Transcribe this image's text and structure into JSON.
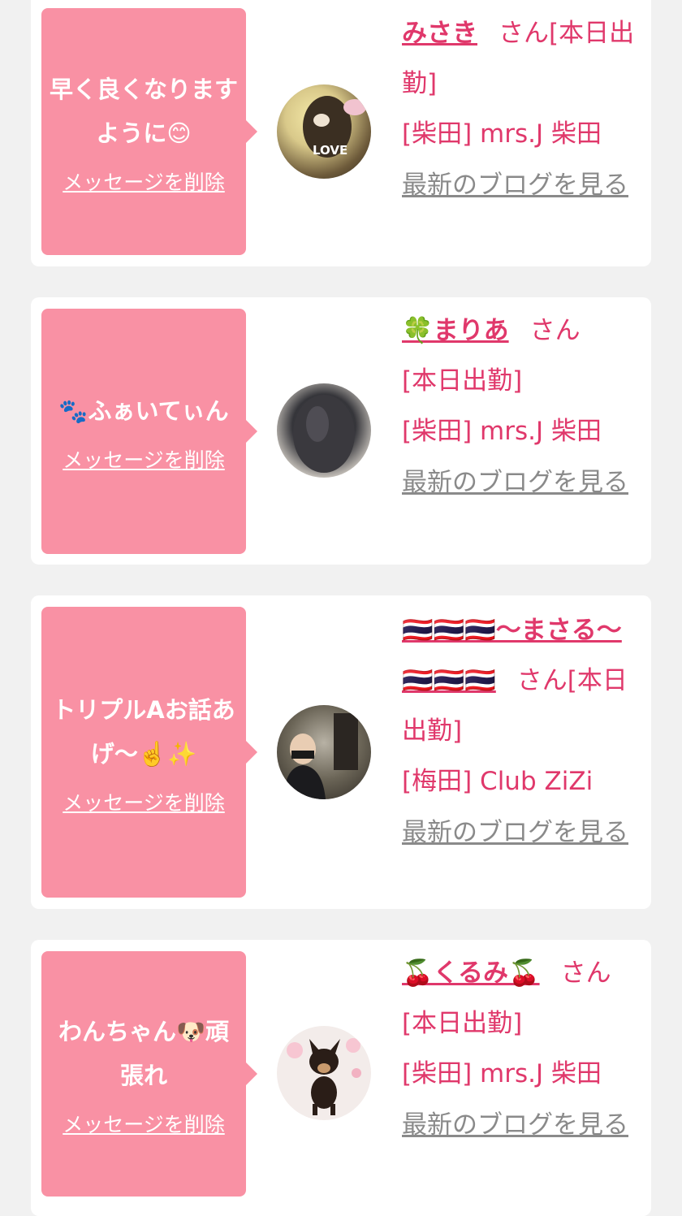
{
  "cards": [
    {
      "message": "早く良くなりますように😊",
      "delete_label": "メッセージを削除",
      "name": "みさき",
      "san": "さん",
      "status": "[本日出勤]",
      "store": "[柴田] mrs.J 柴田",
      "blog_label": "最新のブログを見る"
    },
    {
      "message": "🐾ふぁいてぃん",
      "delete_label": "メッセージを削除",
      "name": "🍀まりあ",
      "san": "さん",
      "status": "[本日出勤]",
      "store": "[柴田] mrs.J 柴田",
      "blog_label": "最新のブログを見る"
    },
    {
      "message": "トリプルAお話あげ〜☝️✨",
      "delete_label": "メッセージを削除",
      "name": "🇹🇭🇹🇭🇹🇭〜まさる〜🇹🇭🇹🇭🇹🇭",
      "san": "さん",
      "status": "[本日出勤]",
      "store": "[梅田] Club ZiZi",
      "blog_label": "最新のブログを見る"
    },
    {
      "message": "わんちゃん🐶頑張れ",
      "delete_label": "メッセージを削除",
      "name": "🍒くるみ🍒",
      "san": "さん",
      "status": "[本日出勤]",
      "store": "[柴田] mrs.J 柴田",
      "blog_label": "最新のブログを見る"
    }
  ],
  "colors": {
    "bubble": "#f991a4",
    "accent": "#e0386b",
    "link_gray": "#8a8a8a",
    "background": "#f1f1f1"
  }
}
